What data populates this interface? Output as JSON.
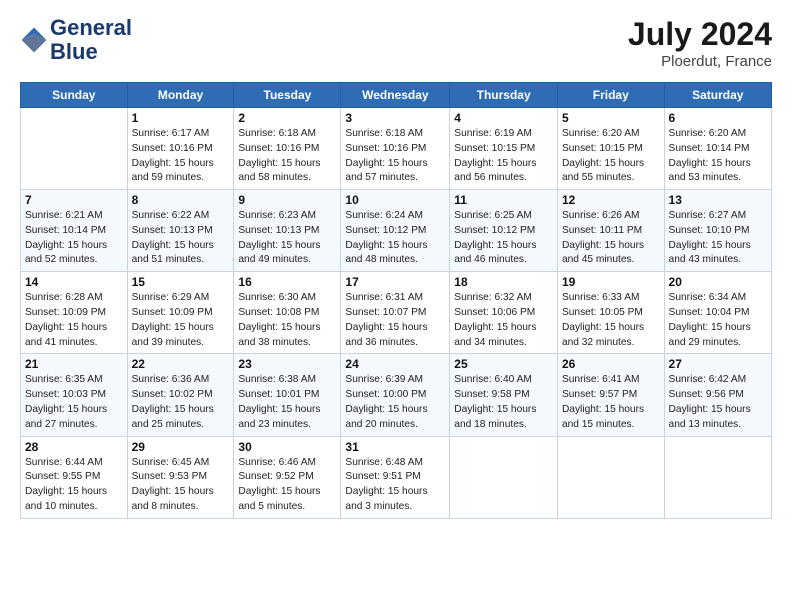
{
  "logo": {
    "line1": "General",
    "line2": "Blue"
  },
  "title": "July 2024",
  "location": "Ploerdut, France",
  "weekdays": [
    "Sunday",
    "Monday",
    "Tuesday",
    "Wednesday",
    "Thursday",
    "Friday",
    "Saturday"
  ],
  "weeks": [
    [
      {
        "day": "",
        "sunrise": "",
        "sunset": "",
        "daylight": ""
      },
      {
        "day": "1",
        "sunrise": "Sunrise: 6:17 AM",
        "sunset": "Sunset: 10:16 PM",
        "daylight": "Daylight: 15 hours and 59 minutes."
      },
      {
        "day": "2",
        "sunrise": "Sunrise: 6:18 AM",
        "sunset": "Sunset: 10:16 PM",
        "daylight": "Daylight: 15 hours and 58 minutes."
      },
      {
        "day": "3",
        "sunrise": "Sunrise: 6:18 AM",
        "sunset": "Sunset: 10:16 PM",
        "daylight": "Daylight: 15 hours and 57 minutes."
      },
      {
        "day": "4",
        "sunrise": "Sunrise: 6:19 AM",
        "sunset": "Sunset: 10:15 PM",
        "daylight": "Daylight: 15 hours and 56 minutes."
      },
      {
        "day": "5",
        "sunrise": "Sunrise: 6:20 AM",
        "sunset": "Sunset: 10:15 PM",
        "daylight": "Daylight: 15 hours and 55 minutes."
      },
      {
        "day": "6",
        "sunrise": "Sunrise: 6:20 AM",
        "sunset": "Sunset: 10:14 PM",
        "daylight": "Daylight: 15 hours and 53 minutes."
      }
    ],
    [
      {
        "day": "7",
        "sunrise": "Sunrise: 6:21 AM",
        "sunset": "Sunset: 10:14 PM",
        "daylight": "Daylight: 15 hours and 52 minutes."
      },
      {
        "day": "8",
        "sunrise": "Sunrise: 6:22 AM",
        "sunset": "Sunset: 10:13 PM",
        "daylight": "Daylight: 15 hours and 51 minutes."
      },
      {
        "day": "9",
        "sunrise": "Sunrise: 6:23 AM",
        "sunset": "Sunset: 10:13 PM",
        "daylight": "Daylight: 15 hours and 49 minutes."
      },
      {
        "day": "10",
        "sunrise": "Sunrise: 6:24 AM",
        "sunset": "Sunset: 10:12 PM",
        "daylight": "Daylight: 15 hours and 48 minutes."
      },
      {
        "day": "11",
        "sunrise": "Sunrise: 6:25 AM",
        "sunset": "Sunset: 10:12 PM",
        "daylight": "Daylight: 15 hours and 46 minutes."
      },
      {
        "day": "12",
        "sunrise": "Sunrise: 6:26 AM",
        "sunset": "Sunset: 10:11 PM",
        "daylight": "Daylight: 15 hours and 45 minutes."
      },
      {
        "day": "13",
        "sunrise": "Sunrise: 6:27 AM",
        "sunset": "Sunset: 10:10 PM",
        "daylight": "Daylight: 15 hours and 43 minutes."
      }
    ],
    [
      {
        "day": "14",
        "sunrise": "Sunrise: 6:28 AM",
        "sunset": "Sunset: 10:09 PM",
        "daylight": "Daylight: 15 hours and 41 minutes."
      },
      {
        "day": "15",
        "sunrise": "Sunrise: 6:29 AM",
        "sunset": "Sunset: 10:09 PM",
        "daylight": "Daylight: 15 hours and 39 minutes."
      },
      {
        "day": "16",
        "sunrise": "Sunrise: 6:30 AM",
        "sunset": "Sunset: 10:08 PM",
        "daylight": "Daylight: 15 hours and 38 minutes."
      },
      {
        "day": "17",
        "sunrise": "Sunrise: 6:31 AM",
        "sunset": "Sunset: 10:07 PM",
        "daylight": "Daylight: 15 hours and 36 minutes."
      },
      {
        "day": "18",
        "sunrise": "Sunrise: 6:32 AM",
        "sunset": "Sunset: 10:06 PM",
        "daylight": "Daylight: 15 hours and 34 minutes."
      },
      {
        "day": "19",
        "sunrise": "Sunrise: 6:33 AM",
        "sunset": "Sunset: 10:05 PM",
        "daylight": "Daylight: 15 hours and 32 minutes."
      },
      {
        "day": "20",
        "sunrise": "Sunrise: 6:34 AM",
        "sunset": "Sunset: 10:04 PM",
        "daylight": "Daylight: 15 hours and 29 minutes."
      }
    ],
    [
      {
        "day": "21",
        "sunrise": "Sunrise: 6:35 AM",
        "sunset": "Sunset: 10:03 PM",
        "daylight": "Daylight: 15 hours and 27 minutes."
      },
      {
        "day": "22",
        "sunrise": "Sunrise: 6:36 AM",
        "sunset": "Sunset: 10:02 PM",
        "daylight": "Daylight: 15 hours and 25 minutes."
      },
      {
        "day": "23",
        "sunrise": "Sunrise: 6:38 AM",
        "sunset": "Sunset: 10:01 PM",
        "daylight": "Daylight: 15 hours and 23 minutes."
      },
      {
        "day": "24",
        "sunrise": "Sunrise: 6:39 AM",
        "sunset": "Sunset: 10:00 PM",
        "daylight": "Daylight: 15 hours and 20 minutes."
      },
      {
        "day": "25",
        "sunrise": "Sunrise: 6:40 AM",
        "sunset": "Sunset: 9:58 PM",
        "daylight": "Daylight: 15 hours and 18 minutes."
      },
      {
        "day": "26",
        "sunrise": "Sunrise: 6:41 AM",
        "sunset": "Sunset: 9:57 PM",
        "daylight": "Daylight: 15 hours and 15 minutes."
      },
      {
        "day": "27",
        "sunrise": "Sunrise: 6:42 AM",
        "sunset": "Sunset: 9:56 PM",
        "daylight": "Daylight: 15 hours and 13 minutes."
      }
    ],
    [
      {
        "day": "28",
        "sunrise": "Sunrise: 6:44 AM",
        "sunset": "Sunset: 9:55 PM",
        "daylight": "Daylight: 15 hours and 10 minutes."
      },
      {
        "day": "29",
        "sunrise": "Sunrise: 6:45 AM",
        "sunset": "Sunset: 9:53 PM",
        "daylight": "Daylight: 15 hours and 8 minutes."
      },
      {
        "day": "30",
        "sunrise": "Sunrise: 6:46 AM",
        "sunset": "Sunset: 9:52 PM",
        "daylight": "Daylight: 15 hours and 5 minutes."
      },
      {
        "day": "31",
        "sunrise": "Sunrise: 6:48 AM",
        "sunset": "Sunset: 9:51 PM",
        "daylight": "Daylight: 15 hours and 3 minutes."
      },
      {
        "day": "",
        "sunrise": "",
        "sunset": "",
        "daylight": ""
      },
      {
        "day": "",
        "sunrise": "",
        "sunset": "",
        "daylight": ""
      },
      {
        "day": "",
        "sunrise": "",
        "sunset": "",
        "daylight": ""
      }
    ]
  ]
}
